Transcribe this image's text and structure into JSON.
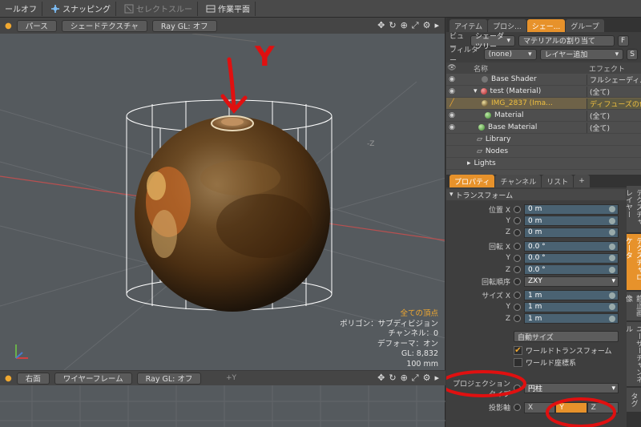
{
  "topbar": {
    "items": [
      "ールオフ",
      "スナッピング",
      "セレクトスルー",
      "作業平面"
    ]
  },
  "viewport": {
    "view_label": "パース",
    "shading_label": "シェードテクスチャ",
    "raygl_label": "Ray GL: オフ",
    "stats": {
      "line1": "全ての頂点",
      "line2": "ポリゴン：サブディビジョン",
      "line3": "チャンネル：0",
      "line4": "デフォーマ：オン",
      "line5": "GL: 8,832",
      "line6": "100 mm"
    },
    "annotation_letter": "Y",
    "axis_label": "-Z"
  },
  "viewport2": {
    "view_label": "右面",
    "shading_label": "ワイヤーフレーム",
    "raygl_label": "Ray GL: オフ",
    "axis_label": "+Y"
  },
  "panel": {
    "tabs": [
      "アイテム",
      "プロシ...",
      "シェー...",
      "グループ"
    ],
    "view_label": "ビュー",
    "view_value": "シェーダツリー",
    "material_btn": "マテリアルの割り当て",
    "filter_label": "フィルター",
    "filter_value": "(none)",
    "layer_add": "レイヤー追加",
    "col_name": "名称",
    "col_effect": "エフェクト",
    "tree": [
      {
        "name": "Base Shader",
        "effect": "フルシェーディ..."
      },
      {
        "name": "test (Material)",
        "effect": "(全て)"
      },
      {
        "name": "IMG_2837 (Ima...",
        "effect": "ディフューズの色"
      },
      {
        "name": "Material",
        "effect": "(全て)"
      },
      {
        "name": "Base Material",
        "effect": "(全て)"
      },
      {
        "name": "Library",
        "effect": ""
      },
      {
        "name": "Nodes",
        "effect": ""
      },
      {
        "name": "Lights",
        "effect": ""
      }
    ],
    "prop_tabs": [
      "プロパティ",
      "チャンネル",
      "リスト"
    ],
    "side_tabs": [
      "テクスチャレイヤー",
      "テクスチャロケータ",
      "静止画像",
      "ユーザーチャンネル",
      "タグ"
    ],
    "transform_title": "トランスフォーム",
    "position_label": "位置",
    "rotation_label": "回転",
    "order_label": "回転順序",
    "size_label": "サイズ",
    "pos": [
      "0 m",
      "0 m",
      "0 m"
    ],
    "rot": [
      "0.0 °",
      "0.0 °",
      "0.0 °"
    ],
    "order": "ZXY",
    "size": [
      "1 m",
      "1 m",
      "1 m"
    ],
    "auto_size": "自動サイズ",
    "world_transform": "ワールドトランスフォーム",
    "world_coord": "ワールド座標系",
    "projection_type_label": "プロジェクションタイプ",
    "projection_type_value": "円柱",
    "projection_axis_label": "投影軸",
    "axis_options": [
      "X",
      "Y",
      "Z"
    ],
    "axis_selected": "Y"
  },
  "colors": {
    "accent": "#e7922b",
    "annotation": "#e01010"
  }
}
